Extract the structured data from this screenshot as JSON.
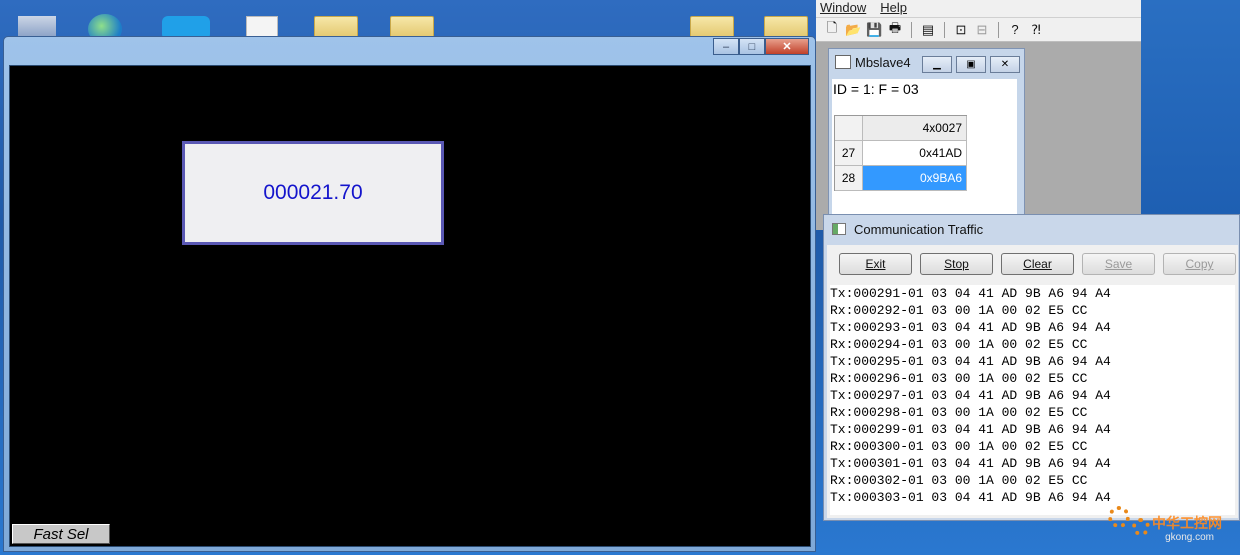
{
  "desktop": {
    "icons": [
      "folder-icon",
      "globe-icon",
      "app-icon",
      "document-icon",
      "folder-icon",
      "folder-icon",
      "folder-icon",
      "folder-icon"
    ]
  },
  "hmi_window": {
    "value_display": "000021.70",
    "fast_sel_label": "Fast Sel",
    "caption": {
      "minimize": "‒",
      "maximize": "□",
      "close": "✕"
    }
  },
  "mbslave_app": {
    "menu": [
      "Window",
      "Help"
    ],
    "toolbar_icons": [
      "new-icon",
      "open-icon",
      "save-icon",
      "print-icon",
      "window-icon",
      "connect-icon",
      "disconnect-icon",
      "help-icon",
      "context-help-icon"
    ],
    "child": {
      "title": "Mbslave4",
      "id_line": "ID = 1: F = 03",
      "column_header": "4x0027",
      "rows": [
        {
          "index": "27",
          "value": "0x41AD",
          "selected": false
        },
        {
          "index": "28",
          "value": "0x9BA6",
          "selected": true
        }
      ]
    }
  },
  "traffic_window": {
    "title": "Communication Traffic",
    "buttons": [
      {
        "label": "Exit",
        "enabled": true
      },
      {
        "label": "Stop",
        "enabled": true
      },
      {
        "label": "Clear",
        "enabled": true
      },
      {
        "label": "Save",
        "enabled": false
      },
      {
        "label": "Copy",
        "enabled": false
      }
    ],
    "log": [
      "Tx:000291-01 03 04 41 AD 9B A6 94 A4",
      "Rx:000292-01 03 00 1A 00 02 E5 CC",
      "Tx:000293-01 03 04 41 AD 9B A6 94 A4",
      "Rx:000294-01 03 00 1A 00 02 E5 CC",
      "Tx:000295-01 03 04 41 AD 9B A6 94 A4",
      "Rx:000296-01 03 00 1A 00 02 E5 CC",
      "Tx:000297-01 03 04 41 AD 9B A6 94 A4",
      "Rx:000298-01 03 00 1A 00 02 E5 CC",
      "Tx:000299-01 03 04 41 AD 9B A6 94 A4",
      "Rx:000300-01 03 00 1A 00 02 E5 CC",
      "Tx:000301-01 03 04 41 AD 9B A6 94 A4",
      "Rx:000302-01 03 00 1A 00 02 E5 CC",
      "Tx:000303-01 03 04 41 AD 9B A6 94 A4"
    ]
  },
  "watermark": {
    "text": "中华工控网",
    "sub": "gkong.com"
  }
}
